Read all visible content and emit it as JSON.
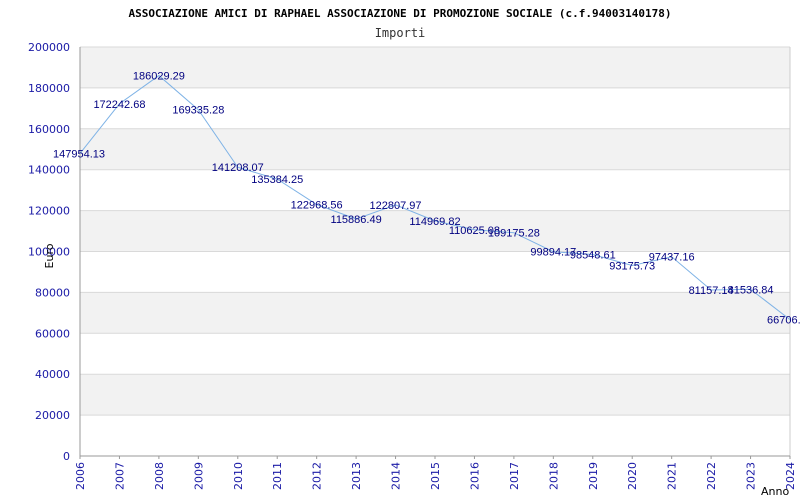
{
  "chart_data": {
    "type": "line",
    "title": "ASSOCIAZIONE AMICI DI RAPHAEL ASSOCIAZIONE DI PROMOZIONE SOCIALE (c.f.94003140178)",
    "subtitle": "Importi",
    "xlabel": "Anno",
    "ylabel": "Euro",
    "ylim": [
      0,
      200000
    ],
    "yticks": [
      "0",
      "20000",
      "40000",
      "60000",
      "80000",
      "100000",
      "120000",
      "140000",
      "160000",
      "180000",
      "200000"
    ],
    "categories": [
      "2006",
      "2007",
      "2008",
      "2009",
      "2010",
      "2011",
      "2012",
      "2013",
      "2014",
      "2015",
      "2016",
      "2017",
      "2018",
      "2019",
      "2020",
      "2021",
      "2022",
      "2023",
      "2024"
    ],
    "series": [
      {
        "values": [
          147954.13,
          172242.68,
          186029.29,
          169335.28,
          141208.07,
          135384.25,
          122968.56,
          115886.49,
          122807.97,
          114969.82,
          110625.08,
          109175.28,
          99894.17,
          98548.61,
          93175.73,
          97437.16,
          81157.14,
          81536.84,
          66706
        ],
        "labels": [
          "147954.13",
          "172242.68",
          "186029.29",
          "169335.28",
          "141208.07",
          "135384.25",
          "122968.56",
          "115886.49",
          "122807.97",
          "114969.82",
          "110625.08",
          "109175.28",
          "99894.17",
          "98548.61",
          "93175.73",
          "97437.16",
          "81157.14",
          "81536.84",
          "66706."
        ]
      }
    ],
    "grid": true,
    "colors": {
      "line": "#7fb3e6",
      "band": "#f2f2f2",
      "grid": "#d9d9d9",
      "tick": "#1a1aa6",
      "label": "#000080"
    }
  }
}
